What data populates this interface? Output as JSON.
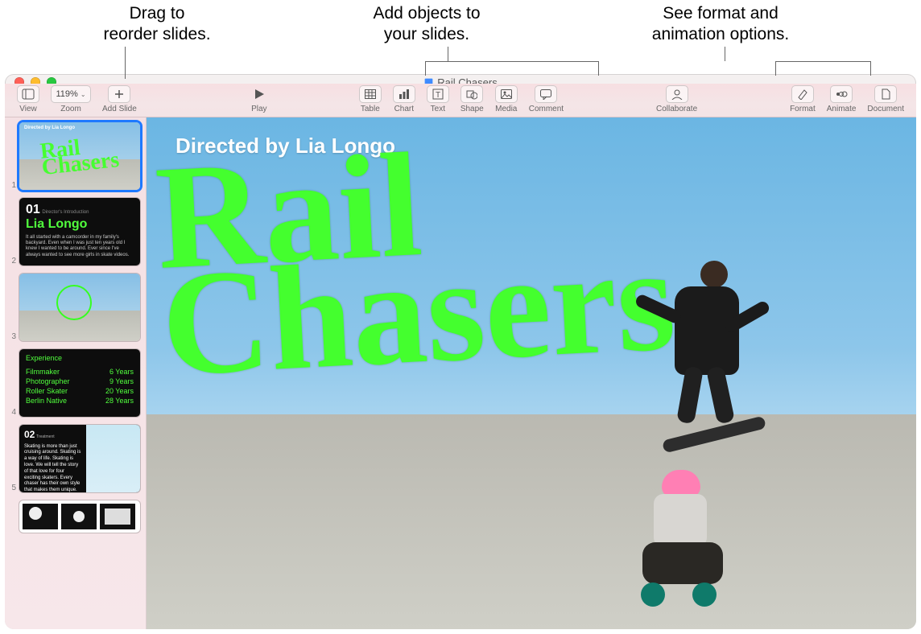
{
  "annotations": {
    "reorder": "Drag to\nreorder slides.",
    "objects": "Add objects to\nyour slides.",
    "format": "See format and\nanimation options."
  },
  "document_title": "Rail Chasers",
  "toolbar": {
    "view": "View",
    "zoom_value": "119%",
    "zoom": "Zoom",
    "add_slide": "Add Slide",
    "play": "Play",
    "table": "Table",
    "chart": "Chart",
    "text": "Text",
    "shape": "Shape",
    "media": "Media",
    "comment": "Comment",
    "collaborate": "Collaborate",
    "format": "Format",
    "animate": "Animate",
    "document": "Document"
  },
  "slides": [
    {
      "n": "1",
      "type": "title",
      "directed": "Directed by Lia Longo",
      "graffiti": "Rail\nChasers"
    },
    {
      "n": "2",
      "type": "intro",
      "num": "01",
      "eyebrow": "Director's Introduction",
      "name": "Lia Longo"
    },
    {
      "n": "3",
      "type": "photo-circle"
    },
    {
      "n": "4",
      "type": "experience",
      "heading": "Experience",
      "rows": [
        {
          "k": "Filmmaker",
          "v": "6 Years"
        },
        {
          "k": "Photographer",
          "v": "9 Years"
        },
        {
          "k": "Roller Skater",
          "v": "20 Years"
        },
        {
          "k": "Berlin Native",
          "v": "28 Years"
        }
      ]
    },
    {
      "n": "5",
      "type": "treatment",
      "num": "02",
      "eyebrow": "Treatment",
      "body": "Skating is more than just cruising around. Skating is a way of life. Skating is love. We will tell the story of that love for four exciting skaters. Every chaser has their own style that makes them unique. Their life, their favorite tricks, and the look they made for themselves."
    },
    {
      "n": "",
      "type": "storyboard"
    }
  ],
  "canvas": {
    "directed": "Directed by Lia Longo",
    "title_line1": "Rail",
    "title_line2": "Chasers"
  }
}
